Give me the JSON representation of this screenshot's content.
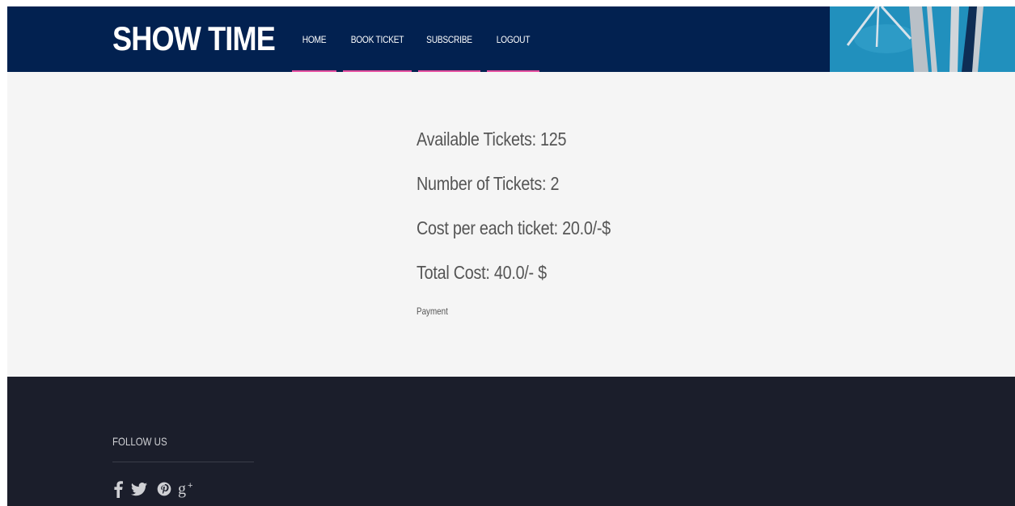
{
  "header": {
    "logo": "SHOW TIME",
    "nav": [
      {
        "label": "HOME"
      },
      {
        "label": "BOOK TICKET"
      },
      {
        "label": "SUBSCRIBE"
      },
      {
        "label": "LOGOUT"
      }
    ]
  },
  "main": {
    "available_tickets": "Available Tickets: 125",
    "number_of_tickets": "Number of Tickets: 2",
    "cost_per_ticket": "Cost per each ticket: 20.0/-$",
    "total_cost": "Total Cost: 40.0/- $",
    "payment_label": "Payment"
  },
  "footer": {
    "follow_title": "FOLLOW US",
    "social": [
      {
        "icon": "facebook-icon"
      },
      {
        "icon": "twitter-icon"
      },
      {
        "icon": "pinterest-icon"
      },
      {
        "icon": "google-plus-icon"
      }
    ]
  },
  "colors": {
    "header_bg": "#022150",
    "nav_underline": "#e64fa0",
    "banner_bg": "#2190bd",
    "content_bg": "#f5f5f5",
    "footer_bg": "#1b1e2b"
  }
}
